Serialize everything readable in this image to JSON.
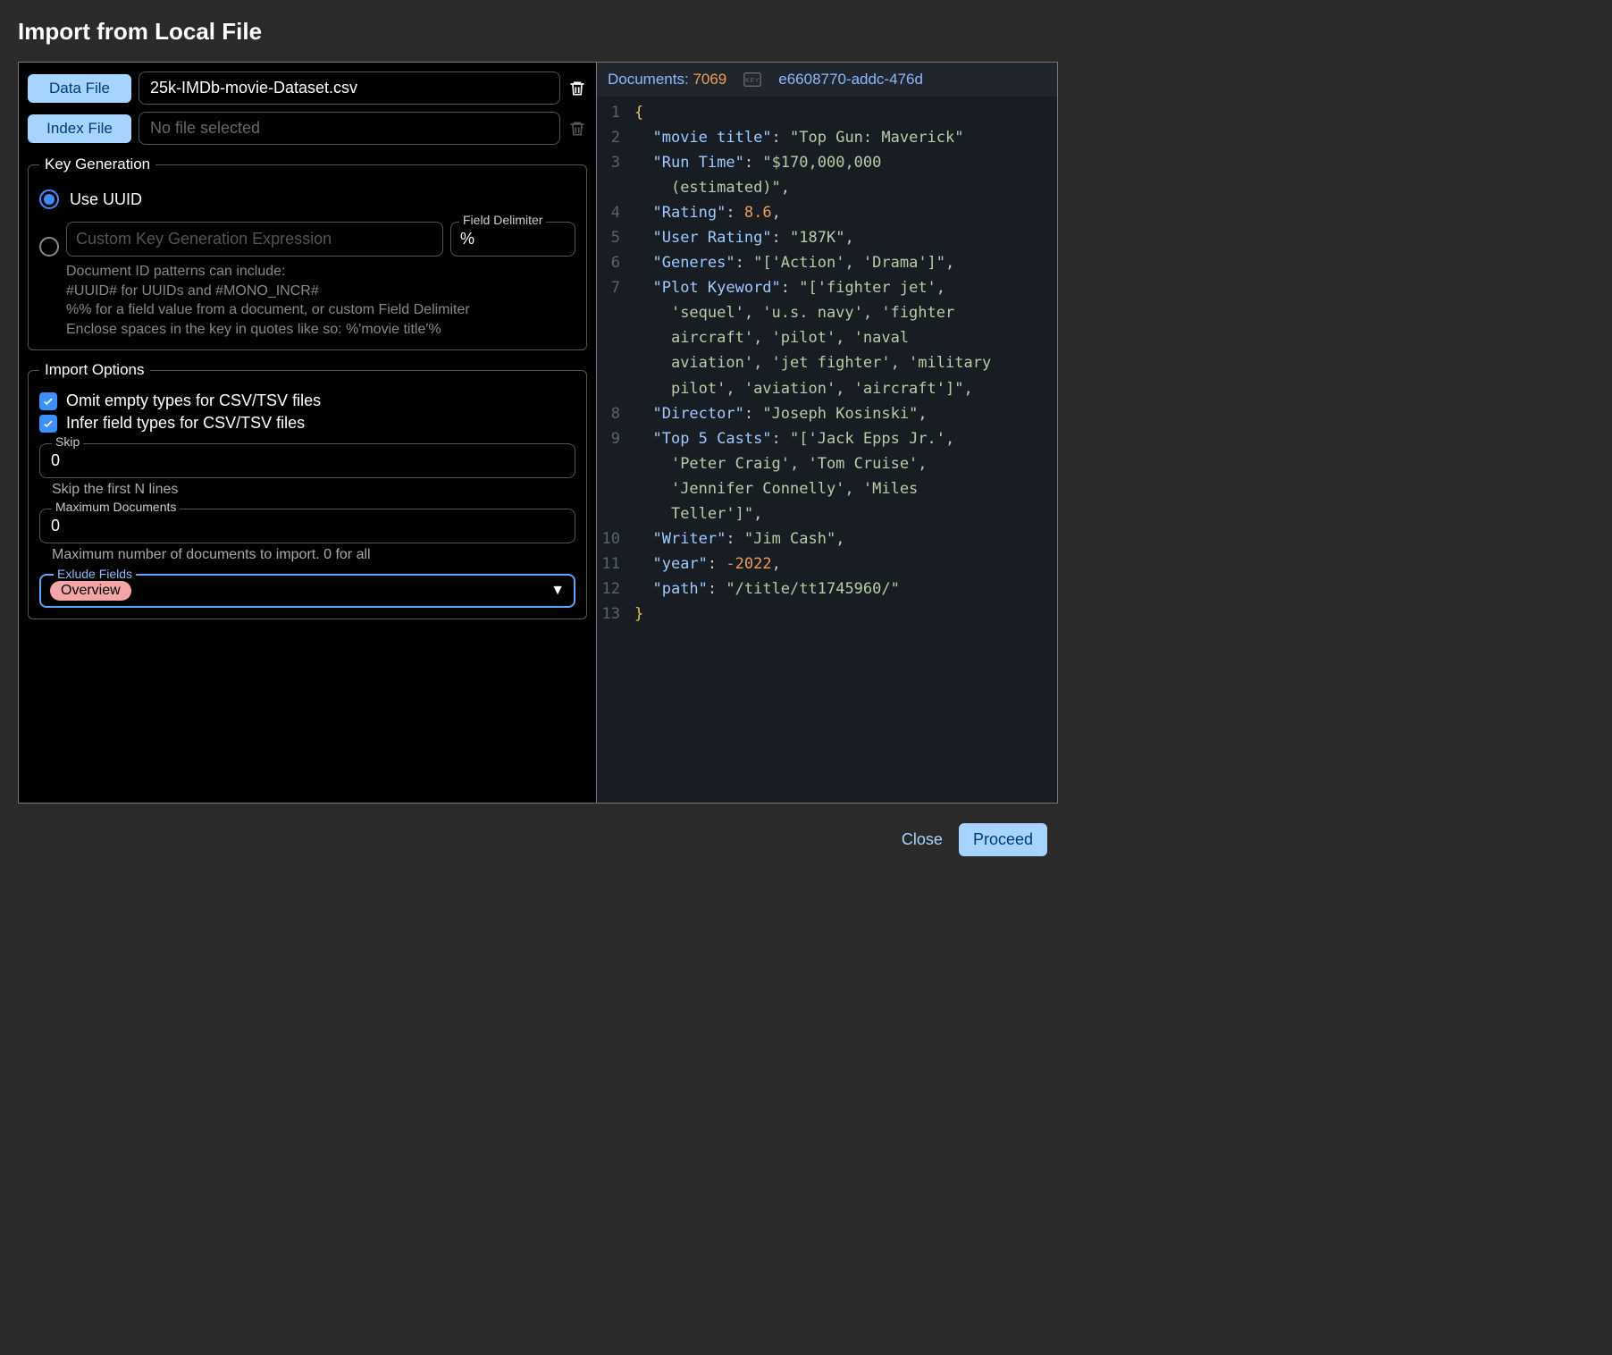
{
  "dialog": {
    "title": "Import from Local File",
    "data_file_button": "Data File",
    "data_file_value": "25k-IMDb-movie-Dataset.csv",
    "index_file_button": "Index File",
    "index_file_placeholder": "No file selected"
  },
  "key_generation": {
    "legend": "Key Generation",
    "use_uuid_label": "Use UUID",
    "custom_expr_placeholder": "Custom Key Generation Expression",
    "field_delimiter_label": "Field Delimiter",
    "field_delimiter_value": "%",
    "help_line1": "Document ID patterns can include:",
    "help_line2": "#UUID# for UUIDs and #MONO_INCR#",
    "help_line3": "%% for a field value from a document, or custom Field Delimiter",
    "help_line4": "Enclose spaces in the key in quotes like so: %'movie title'%"
  },
  "import_options": {
    "legend": "Import Options",
    "omit_empty_label": "Omit empty types for CSV/TSV files",
    "infer_types_label": "Infer field types for CSV/TSV files",
    "skip_label": "Skip",
    "skip_value": "0",
    "skip_hint": "Skip the first N lines",
    "max_docs_label": "Maximum Documents",
    "max_docs_value": "0",
    "max_docs_hint": "Maximum number of documents to import. 0 for all",
    "exclude_label": "Exlude Fields",
    "exclude_chip": "Overview"
  },
  "preview": {
    "documents_label": "Documents: ",
    "documents_count": "7069",
    "doc_id": "e6608770-addc-476d",
    "json_lines": [
      {
        "n": 1,
        "ind": 0,
        "type": "open"
      },
      {
        "n": 2,
        "ind": 1,
        "type": "kv",
        "key": "movie title",
        "val": "\"Top Gun: Maverick\"",
        "vt": "str",
        "comma": true,
        "wrap": true
      },
      {
        "n": 3,
        "ind": 1,
        "type": "kv",
        "key": "Run Time",
        "val": "\"$170,000,000 (estimated)\"",
        "vt": "str",
        "comma": true,
        "wrap": true
      },
      {
        "n": 4,
        "ind": 1,
        "type": "kv",
        "key": "Rating",
        "val": "8.6",
        "vt": "num",
        "comma": true
      },
      {
        "n": 5,
        "ind": 1,
        "type": "kv",
        "key": "User Rating",
        "val": "\"187K\"",
        "vt": "str",
        "comma": true
      },
      {
        "n": 6,
        "ind": 1,
        "type": "kv",
        "key": "Generes",
        "val": "\"['Action', 'Drama']\"",
        "vt": "str",
        "comma": true
      },
      {
        "n": 7,
        "ind": 1,
        "type": "kv",
        "key": "Plot Kyeword",
        "val": "\"['fighter jet', 'sequel', 'u.s. navy', 'fighter aircraft', 'pilot', 'naval aviation', 'jet fighter', 'military pilot', 'aviation', 'aircraft']\"",
        "vt": "str",
        "comma": true,
        "wrap": true
      },
      {
        "n": 8,
        "ind": 1,
        "type": "kv",
        "key": "Director",
        "val": "\"Joseph Kosinski\"",
        "vt": "str",
        "comma": true
      },
      {
        "n": 9,
        "ind": 1,
        "type": "kv",
        "key": "Top 5 Casts",
        "val": "\"['Jack Epps Jr.', 'Peter Craig', 'Tom Cruise', 'Jennifer Connelly', 'Miles Teller']\"",
        "vt": "str",
        "comma": true,
        "wrap": true
      },
      {
        "n": 10,
        "ind": 1,
        "type": "kv",
        "key": "Writer",
        "val": "\"Jim Cash\"",
        "vt": "str",
        "comma": true
      },
      {
        "n": 11,
        "ind": 1,
        "type": "kv",
        "key": "year",
        "val": "-2022",
        "vt": "neg",
        "comma": true
      },
      {
        "n": 12,
        "ind": 1,
        "type": "kv",
        "key": "path",
        "val": "\"/title/tt1745960/\"",
        "vt": "str",
        "comma": false
      },
      {
        "n": 13,
        "ind": 0,
        "type": "close"
      }
    ]
  },
  "footer": {
    "close": "Close",
    "proceed": "Proceed"
  }
}
